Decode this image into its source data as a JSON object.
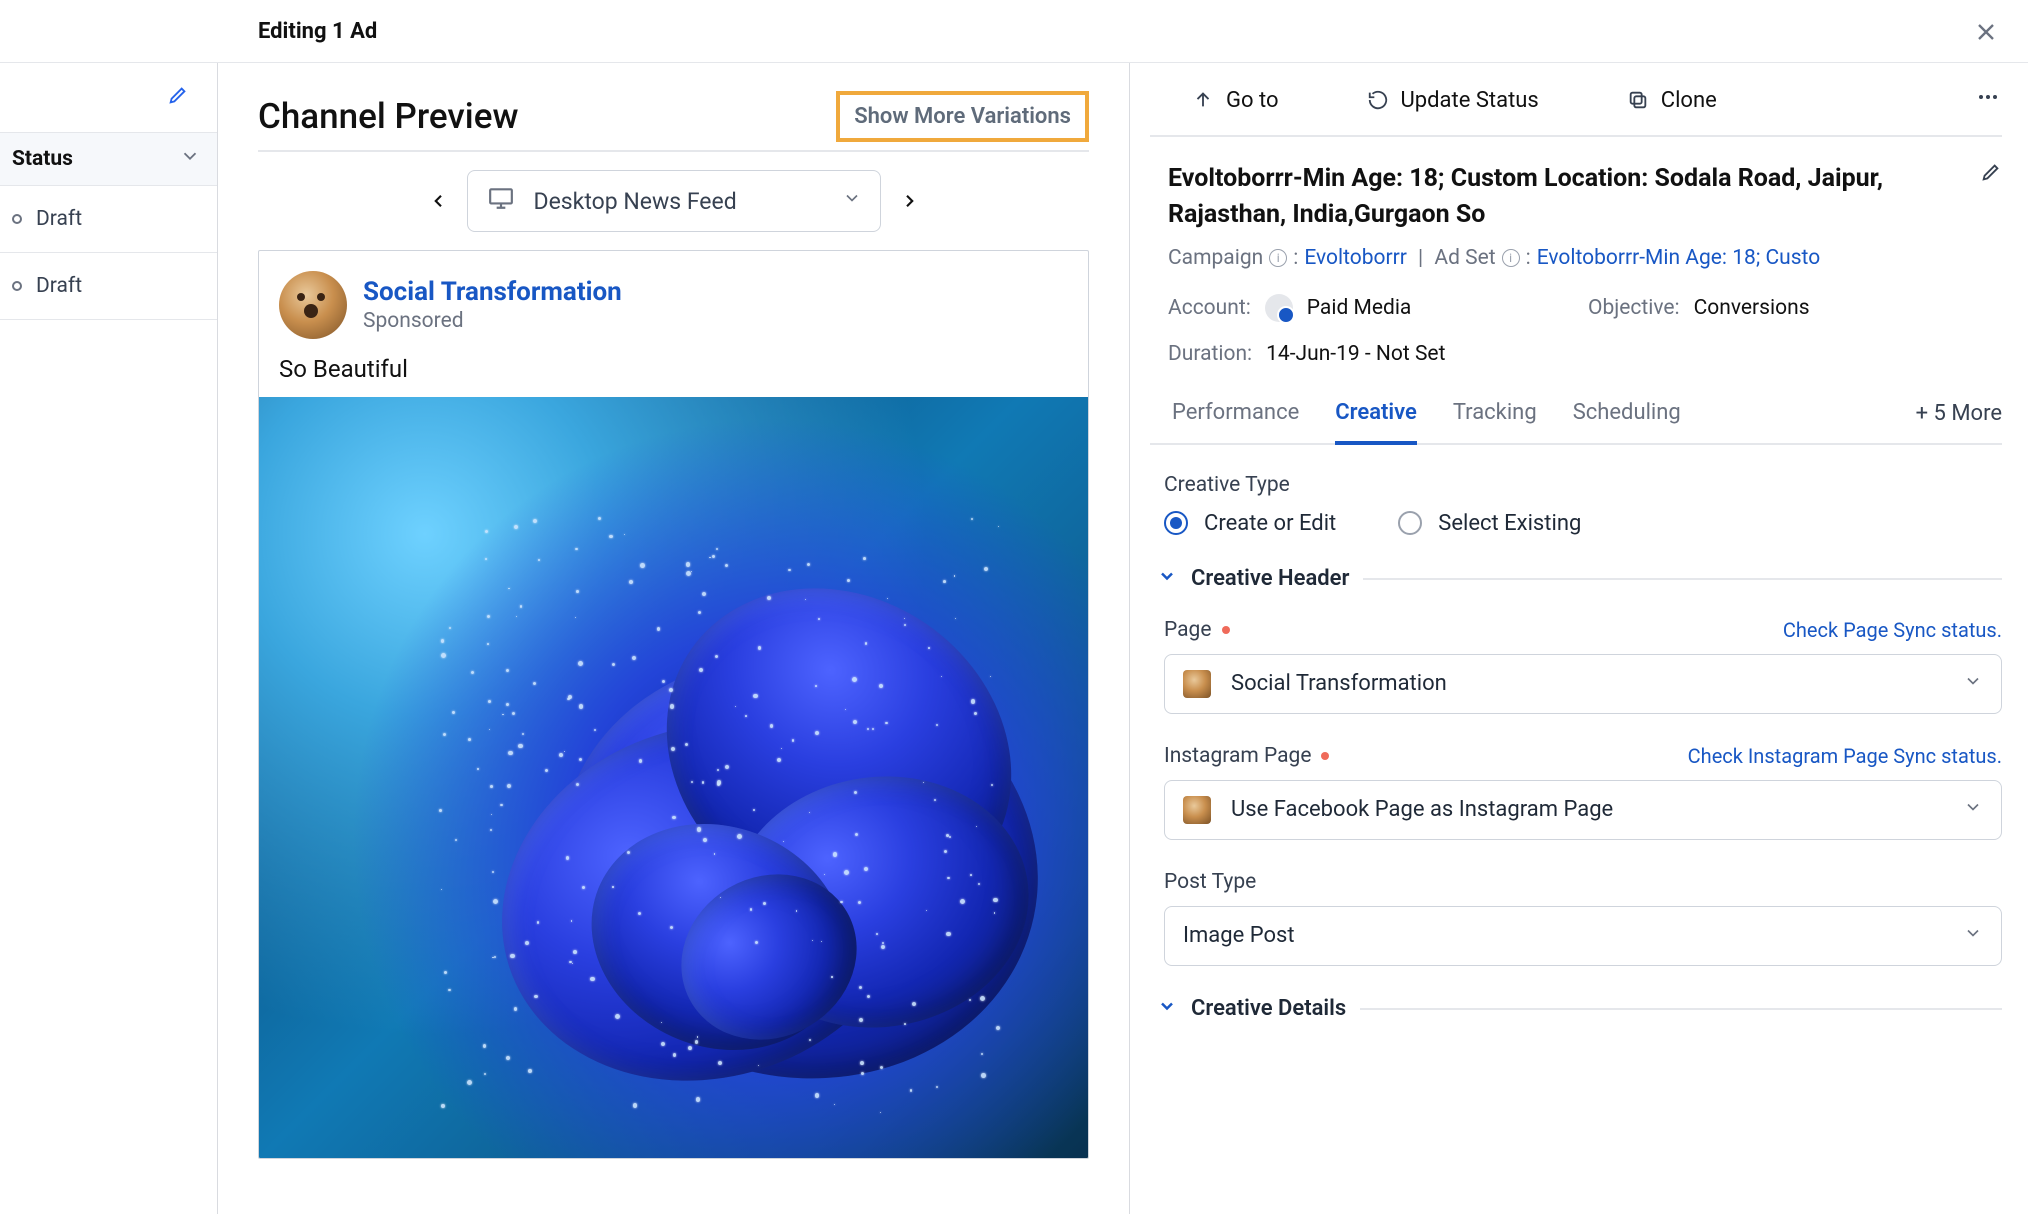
{
  "topbar": {
    "title": "Editing 1 Ad"
  },
  "leftrail": {
    "header": "Status",
    "items": [
      "Draft",
      "Draft"
    ]
  },
  "preview": {
    "heading": "Channel Preview",
    "show_more": "Show More Variations",
    "feed_selector": "Desktop News Feed",
    "post": {
      "page_name": "Social Transformation",
      "sponsored": "Sponsored",
      "text": "So Beautiful"
    }
  },
  "actions": {
    "goto": "Go to",
    "update_status": "Update Status",
    "clone": "Clone"
  },
  "ad": {
    "title": "Evoltoborrr-Min Age: 18; Custom Location: Sodala Road, Jaipur, Rajasthan, India,Gurgaon So",
    "campaign_label": "Campaign",
    "campaign_link": "Evoltoborrr",
    "adset_label": "Ad Set",
    "adset_link": "Evoltoborrr-Min Age: 18; Custo",
    "account_label": "Account:",
    "account_value": "Paid Media",
    "objective_label": "Objective:",
    "objective_value": "Conversions",
    "duration_label": "Duration:",
    "duration_value": "14-Jun-19 - Not Set"
  },
  "tabs": {
    "items": [
      "Performance",
      "Creative",
      "Tracking",
      "Scheduling"
    ],
    "active": "Creative",
    "more": "+ 5 More"
  },
  "creative": {
    "type_label": "Creative Type",
    "opt_create": "Create or Edit",
    "opt_select": "Select Existing",
    "header_section": "Creative Header",
    "page_label": "Page",
    "page_sync": "Check Page Sync status.",
    "page_value": "Social Transformation",
    "insta_label": "Instagram Page",
    "insta_sync": "Check Instagram Page Sync status.",
    "insta_value": "Use Facebook Page as Instagram Page",
    "post_type_label": "Post Type",
    "post_type_value": "Image Post",
    "details_section": "Creative Details"
  }
}
